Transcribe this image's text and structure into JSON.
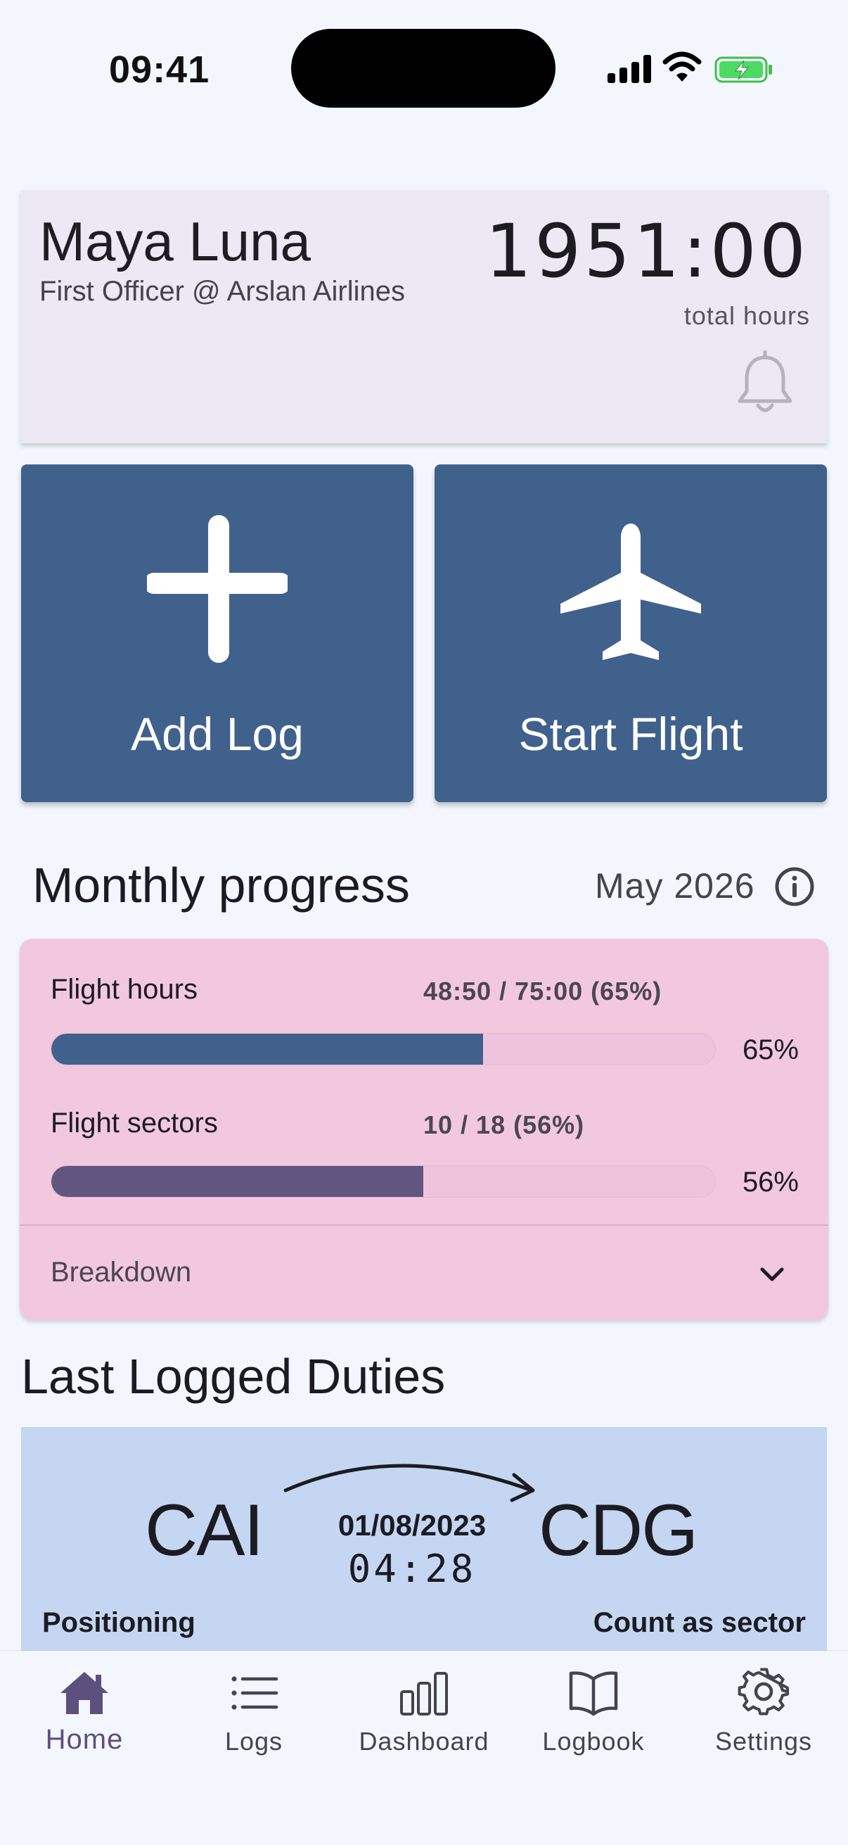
{
  "status_bar": {
    "time": "09:41"
  },
  "profile": {
    "name": "Maya Luna",
    "role": "First Officer @ Arslan Airlines",
    "total_hours": "1951:00",
    "total_hours_label": "total hours"
  },
  "actions": {
    "add_log": "Add Log",
    "start_flight": "Start Flight"
  },
  "monthly_progress": {
    "title": "Monthly progress",
    "period": "May 2026",
    "items": [
      {
        "label": "Flight hours",
        "value": "48:50 / 75:00 (65%)",
        "percent_text": "65%",
        "fraction": 0.65,
        "color": "#3f618c"
      },
      {
        "label": "Flight sectors",
        "value": "10 / 18 (56%)",
        "percent_text": "56%",
        "fraction": 0.56,
        "color": "#625680"
      }
    ],
    "breakdown_label": "Breakdown"
  },
  "last_logged": {
    "title": "Last Logged Duties",
    "duty": {
      "origin": "CAI",
      "destination": "CDG",
      "date": "01/08/2023",
      "duration": "04:28",
      "type": "Positioning",
      "count_label": "Count as sector"
    }
  },
  "nav": {
    "items": [
      {
        "label": "Home",
        "icon": "home-icon",
        "active": true
      },
      {
        "label": "Logs",
        "icon": "list-icon",
        "active": false
      },
      {
        "label": "Dashboard",
        "icon": "bar-chart-icon",
        "active": false
      },
      {
        "label": "Logbook",
        "icon": "book-icon",
        "active": false
      },
      {
        "label": "Settings",
        "icon": "gear-icon",
        "active": false
      }
    ]
  },
  "colors": {
    "background": "#f3f7fd",
    "profile_card": "#ece8f4",
    "tile": "#3f618c",
    "progress_card": "#f2c8df",
    "duty_card": "#c4d6f2",
    "active_nav": "#5d4f7e"
  }
}
